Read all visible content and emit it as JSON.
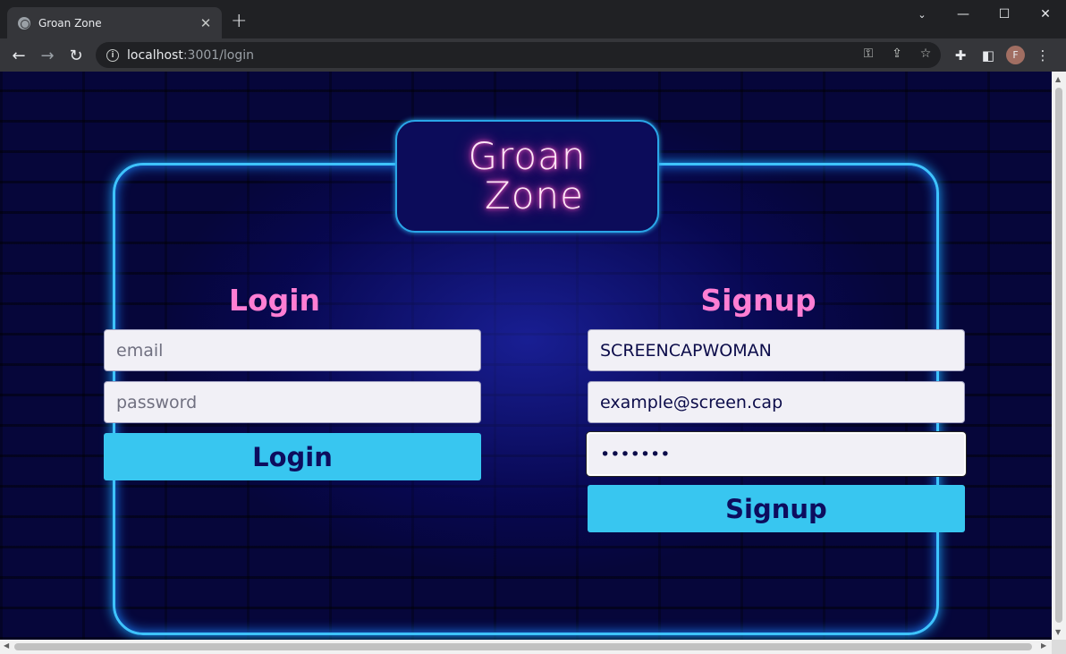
{
  "browser": {
    "tab_title": "Groan Zone",
    "url_host": "localhost",
    "url_path": ":3001/login",
    "avatar_letter": "F"
  },
  "page": {
    "logo": {
      "line1": "Groan",
      "line2": "Zone"
    },
    "login": {
      "heading": "Login",
      "email_placeholder": "email",
      "password_placeholder": "password",
      "button_label": "Login"
    },
    "signup": {
      "heading": "Signup",
      "username_value": "SCREENCAPWOMAN",
      "email_value": "example@screen.cap",
      "password_value": "•••••••",
      "button_label": "Signup"
    }
  },
  "colors": {
    "heading_pink": "#ff7ed3",
    "button_cyan": "#38c6f0",
    "button_text": "#0d0d5e",
    "neon_frame": "#3ec3ff"
  }
}
